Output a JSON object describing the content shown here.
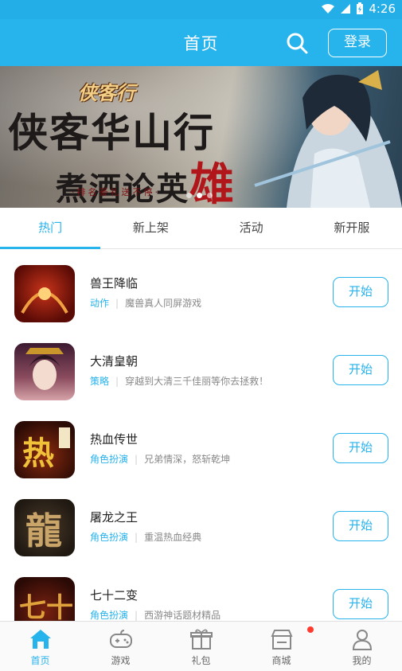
{
  "status_bar": {
    "time": "4:26",
    "icons": [
      "wifi-icon",
      "signal-icon",
      "battery-icon"
    ]
  },
  "header": {
    "title": "首页",
    "login_label": "登录",
    "search_icon": "search-icon"
  },
  "banner": {
    "logo_text": "侠客行",
    "line1": "侠客华山行",
    "line2_prefix": "煮酒论英",
    "line2_highlight": "雄",
    "subtitle": "·排名豪礼送不停·",
    "slide_count": 3,
    "active_slide": 1
  },
  "tabs": [
    {
      "label": "热门",
      "active": true
    },
    {
      "label": "新上架",
      "active": false
    },
    {
      "label": "活动",
      "active": false
    },
    {
      "label": "新开服",
      "active": false
    }
  ],
  "games": [
    {
      "name": "兽王降临",
      "category": "动作",
      "desc": "魔兽真人同屏游戏",
      "button": "开始",
      "icon": "beast-king-game-icon",
      "icon_colors": [
        "#5a0b06",
        "#c8341a"
      ]
    },
    {
      "name": "大清皇朝",
      "category": "策略",
      "desc": "穿越到大清三千佳丽等你去拯救！",
      "button": "开始",
      "icon": "qing-dynasty-game-icon",
      "icon_colors": [
        "#3c1a30",
        "#d6a3a8"
      ]
    },
    {
      "name": "热血传世",
      "category": "角色扮演",
      "desc": "兄弟情深，怒斩乾坤",
      "button": "开始",
      "icon": "hot-blood-game-icon",
      "icon_colors": [
        "#2a0b05",
        "#f0c23a"
      ]
    },
    {
      "name": "屠龙之王",
      "category": "角色扮演",
      "desc": "重温热血经典",
      "button": "开始",
      "icon": "dragon-slayer-game-icon",
      "icon_colors": [
        "#201912",
        "#c9a56a"
      ]
    },
    {
      "name": "七十二变",
      "category": "角色扮演",
      "desc": "西游神话题材精品",
      "button": "开始",
      "icon": "seventy-two-game-icon",
      "icon_colors": [
        "#2b0a06",
        "#e0a23a"
      ]
    }
  ],
  "bottom_nav": [
    {
      "label": "首页",
      "icon": "home-icon",
      "active": true
    },
    {
      "label": "游戏",
      "icon": "gamepad-icon",
      "active": false
    },
    {
      "label": "礼包",
      "icon": "gift-icon",
      "active": false
    },
    {
      "label": "商城",
      "icon": "store-icon",
      "active": false,
      "badge": true
    },
    {
      "label": "我的",
      "icon": "user-icon",
      "active": false
    }
  ],
  "colors": {
    "accent": "#27b3ec",
    "badge": "#ff3b2f"
  }
}
